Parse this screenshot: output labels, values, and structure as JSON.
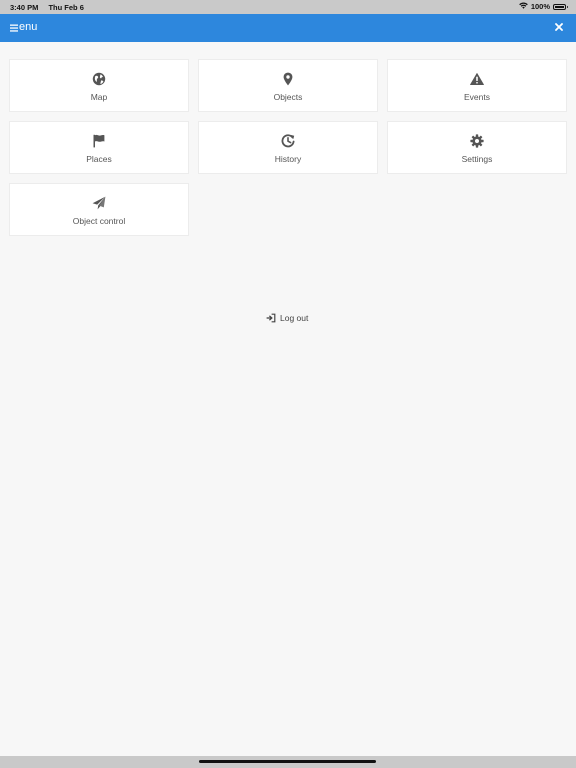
{
  "status_bar": {
    "time": "3:40 PM",
    "date": "Thu Feb 6",
    "battery": "100%",
    "battery_level": 1.0
  },
  "header": {
    "title": "enu",
    "menu_icon": "hamburger-icon",
    "close_icon": "close-icon",
    "background_color": "#2d87dd"
  },
  "tiles": [
    {
      "label": "Map",
      "icon": "globe-icon"
    },
    {
      "label": "Objects",
      "icon": "map-pin-icon"
    },
    {
      "label": "Events",
      "icon": "warning-icon"
    },
    {
      "label": "Places",
      "icon": "flag-icon"
    },
    {
      "label": "History",
      "icon": "history-icon"
    },
    {
      "label": "Settings",
      "icon": "gear-icon"
    },
    {
      "label": "Object control",
      "icon": "paper-plane-icon"
    }
  ],
  "logout": {
    "label": "Log out",
    "icon": "sign-out-icon"
  }
}
